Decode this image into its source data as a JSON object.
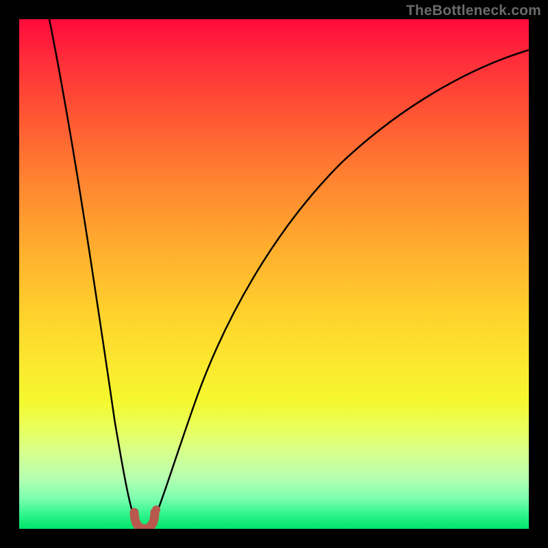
{
  "watermark": "TheBottleneck.com",
  "colors": {
    "frame": "#000000",
    "curve": "#000000",
    "marker": "#b9584c",
    "gradient_top": "#ff0a3c",
    "gradient_mid": "#ffd22c",
    "gradient_bottom": "#00e46a"
  },
  "chart_data": {
    "type": "line",
    "title": "",
    "xlabel": "",
    "ylabel": "",
    "xlim": [
      0,
      100
    ],
    "ylim": [
      0,
      100
    ],
    "series": [
      {
        "name": "bottleneck-curve",
        "x": [
          6,
          10,
          15,
          19,
          22.5,
          24,
          26.5,
          30,
          35,
          45,
          60,
          80,
          100
        ],
        "y": [
          100,
          76,
          44,
          21,
          4,
          0,
          4,
          20,
          40,
          66,
          84,
          92,
          94
        ]
      }
    ],
    "annotations": [
      {
        "name": "optimal-marker",
        "x": 24.5,
        "y": 0,
        "shape": "U",
        "color": "#b9584c"
      }
    ],
    "background": "vertical-gradient red→yellow→green (value = y position, green = low / good)"
  }
}
